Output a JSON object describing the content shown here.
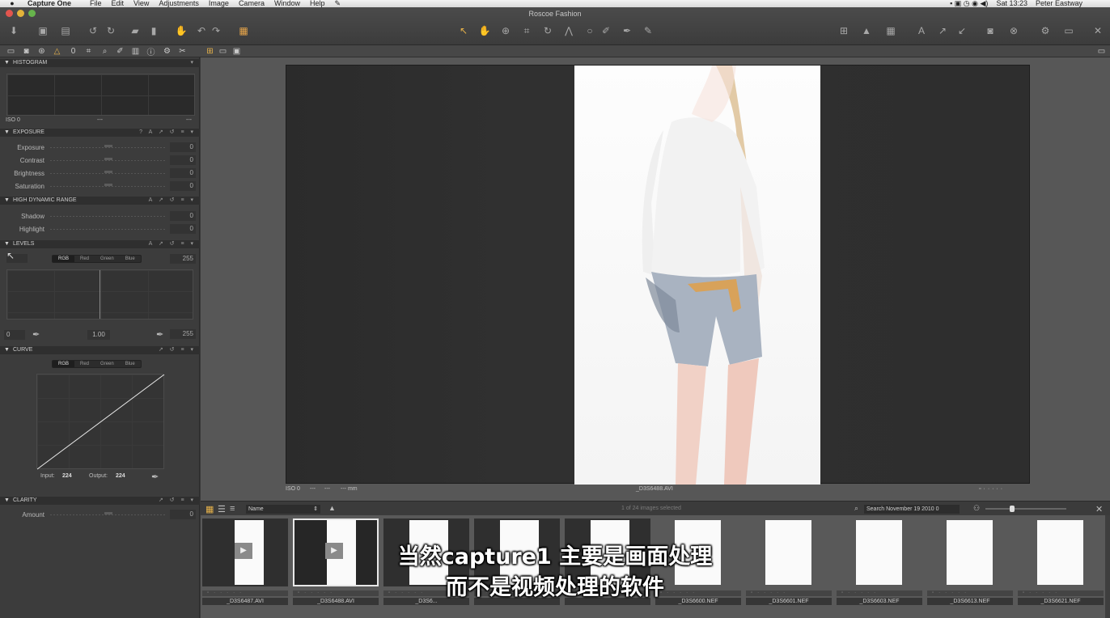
{
  "menubar": {
    "app": "Capture One",
    "menus": [
      "File",
      "Edit",
      "View",
      "Adjustments",
      "Image",
      "Camera",
      "Window",
      "Help"
    ],
    "clock": "Sat 13:23",
    "user": "Peter Eastway"
  },
  "window": {
    "title": "Roscoe Fashion"
  },
  "panels": {
    "histogram": {
      "title": "HISTOGRAM",
      "iso": "ISO 0",
      "dash1": "---",
      "dash2": "---"
    },
    "exposure": {
      "title": "EXPOSURE",
      "rows": [
        {
          "label": "Exposure",
          "value": "0"
        },
        {
          "label": "Contrast",
          "value": "0"
        },
        {
          "label": "Brightness",
          "value": "0"
        },
        {
          "label": "Saturation",
          "value": "0"
        }
      ]
    },
    "hdr": {
      "title": "HIGH DYNAMIC RANGE",
      "rows": [
        {
          "label": "Shadow",
          "value": "0"
        },
        {
          "label": "Highlight",
          "value": "0"
        }
      ]
    },
    "levels": {
      "title": "LEVELS",
      "channels": [
        "RGB",
        "Red",
        "Green",
        "Blue"
      ],
      "top_right": "255",
      "bottom_left": "0",
      "mid": "1.00",
      "bottom_right": "255"
    },
    "curve": {
      "title": "CURVE",
      "channels": [
        "RGB",
        "Red",
        "Green",
        "Blue"
      ],
      "input_label": "Input:",
      "input_value": "224",
      "output_label": "Output:",
      "output_value": "224"
    },
    "clarity": {
      "title": "CLARITY",
      "rows": [
        {
          "label": "Amount",
          "value": "0"
        }
      ]
    }
  },
  "viewer": {
    "iso": "ISO 0",
    "d1": "---",
    "d2": "---",
    "mm": "--- mm",
    "filename": "_D3S6488.AVI"
  },
  "browser": {
    "sort": "Name",
    "count": "1 of 24 images selected",
    "search": "Search November 19 2010 0",
    "thumbs": [
      {
        "name": "_D3S6487.AVI",
        "video": true
      },
      {
        "name": "_D3S6488.AVI",
        "video": true
      },
      {
        "name": "_D3S6...",
        "video": true
      },
      {
        "name": "",
        "video": true
      },
      {
        "name": "",
        "video": true
      },
      {
        "name": "_D3S6600.NEF",
        "video": false
      },
      {
        "name": "_D3S6601.NEF",
        "video": false
      },
      {
        "name": "_D3S6603.NEF",
        "video": false
      },
      {
        "name": "_D3S6613.NEF",
        "video": false
      },
      {
        "name": "_D3S6621.NEF",
        "video": false
      }
    ]
  },
  "subtitle": {
    "line1": "当然capture1 主要是画面处理",
    "line2": "而不是视频处理的软件"
  },
  "colors": {
    "accent": "#e7b24a",
    "panel": "#3c3c3c",
    "viewer_bg": "#575757"
  }
}
